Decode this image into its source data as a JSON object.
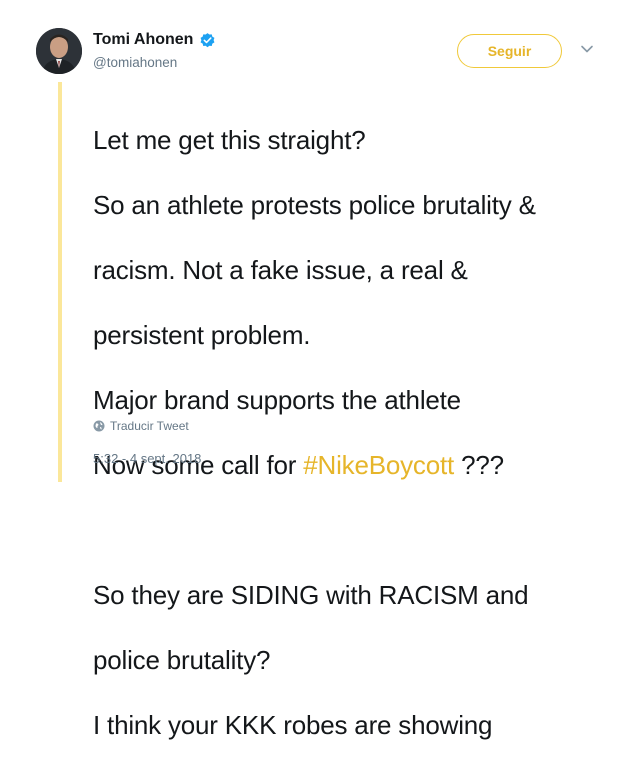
{
  "author": {
    "name": "Tomi Ahonen",
    "handle": "@tomiahonen"
  },
  "actions": {
    "follow_label": "Seguir",
    "translate_label": "Traducir Tweet"
  },
  "tweet": {
    "lines": [
      "Let me get this straight?",
      "So an athlete protests police brutality &",
      "racism. Not a fake issue, a real &",
      "persistent problem.",
      "Major brand supports the athlete",
      "Now some call for",
      "#NikeBoycott",
      "???",
      "So they are SIDING with RACISM and",
      "police brutality?",
      "I think your KKK robes are showing"
    ]
  },
  "timestamp": "5:32 - 4 sept. 2018",
  "colors": {
    "accent": "#e6b52a",
    "verified": "#1da1f2",
    "thread_line": "#fbe79a",
    "muted": "#657786"
  },
  "icons": [
    "verified-badge-icon",
    "chevron-down-icon",
    "globe-icon"
  ]
}
